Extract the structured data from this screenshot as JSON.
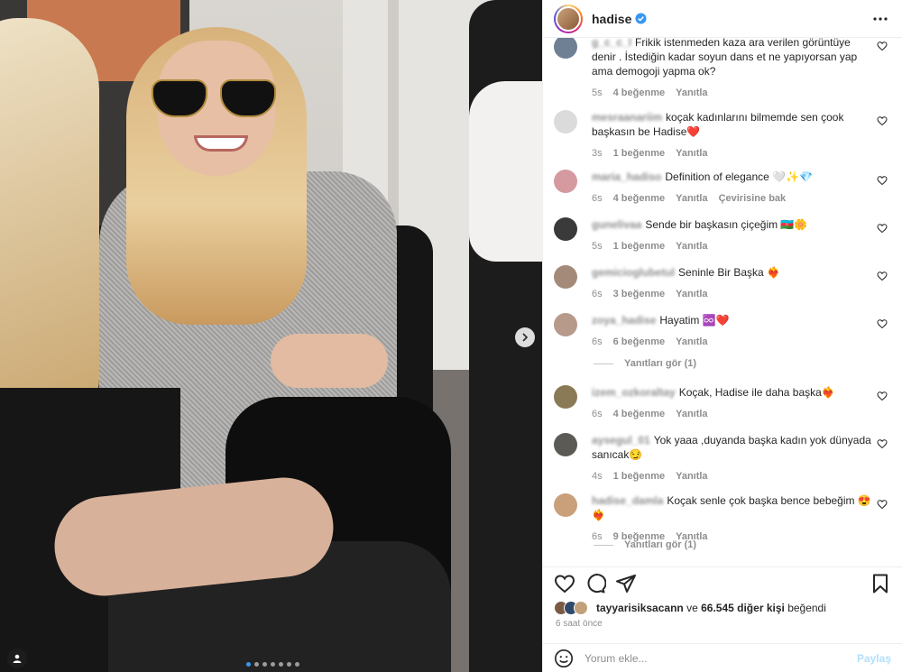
{
  "post": {
    "username": "hadise",
    "verified": true,
    "media_slide_count": 7,
    "media_active_slide": 1
  },
  "comments": [
    {
      "user": "g_c_c_l",
      "text": "Frikik istenmeden kaza ara verilen görüntüye denir . İstediğin kadar soyun dans et ne yapıyorsan yap ama demogoji yapma ok?",
      "time": "5s",
      "likes": "4 beğenme",
      "reply": "Yanıtla",
      "avatar_color": "#6f7f94"
    },
    {
      "user": "mesraanariim",
      "text": "koçak kadınlarını bilmemde sen çook başkasın be Hadise❤️",
      "time": "3s",
      "likes": "1 beğenme",
      "reply": "Yanıtla",
      "avatar_color": "#dbdbdb"
    },
    {
      "user": "maria_hadiso",
      "text": "Definition of elegance 🤍✨💎",
      "time": "6s",
      "likes": "4 beğenme",
      "reply": "Yanıtla",
      "translate": "Çevirisine bak",
      "avatar_color": "#d49aa0"
    },
    {
      "user": "gunelivaa",
      "text": "Sende bir başkasın çiçeğim 🇦🇿🌼",
      "time": "5s",
      "likes": "1 beğenme",
      "reply": "Yanıtla",
      "avatar_color": "#3a3a3a"
    },
    {
      "user": "gemicioglubetul",
      "text": "Seninle Bir Başka ❤️‍🔥",
      "time": "6s",
      "likes": "3 beğenme",
      "reply": "Yanıtla",
      "avatar_color": "#a48a78"
    },
    {
      "user": "zoya_hadise",
      "text": "Hayatim ♾️❤️",
      "time": "6s",
      "likes": "6 beğenme",
      "reply": "Yanıtla",
      "avatar_color": "#b79a8a"
    },
    {
      "user": "izem_ozkoraltay",
      "text": "Koçak, Hadise ile daha başka❤️‍🔥",
      "time": "6s",
      "likes": "4 beğenme",
      "reply": "Yanıtla",
      "avatar_color": "#8a7a55"
    },
    {
      "user": "aysegul_01",
      "text": "Yok yaaa ,duyanda başka kadın yok dünyada sanıcak😏",
      "time": "4s",
      "likes": "1 beğenme",
      "reply": "Yanıtla",
      "avatar_color": "#5c5a55"
    },
    {
      "user": "hadise_damla",
      "text": "Koçak senle çok başka bence bebeğim 😍❤️‍🔥",
      "time": "6s",
      "likes": "9 beğenme",
      "reply": "Yanıtla",
      "avatar_color": "#c9a07a"
    }
  ],
  "view_replies": [
    "Yanıtları gör (1)",
    "Yanıtları gör (1)"
  ],
  "likes_bar": {
    "first_liker": "tayyarisiksacann",
    "connector": "ve",
    "others": "66.545 diğer kişi",
    "suffix": "beğendi"
  },
  "time_ago": "6 saat önce",
  "comment_box": {
    "placeholder": "Yorum ekle...",
    "post_label": "Paylaş"
  },
  "icons": [
    "verified-icon",
    "more-icon",
    "heart-icon",
    "comment-icon",
    "share-icon",
    "save-icon",
    "emoji-icon",
    "chevron-right-icon",
    "user-tag-icon"
  ]
}
